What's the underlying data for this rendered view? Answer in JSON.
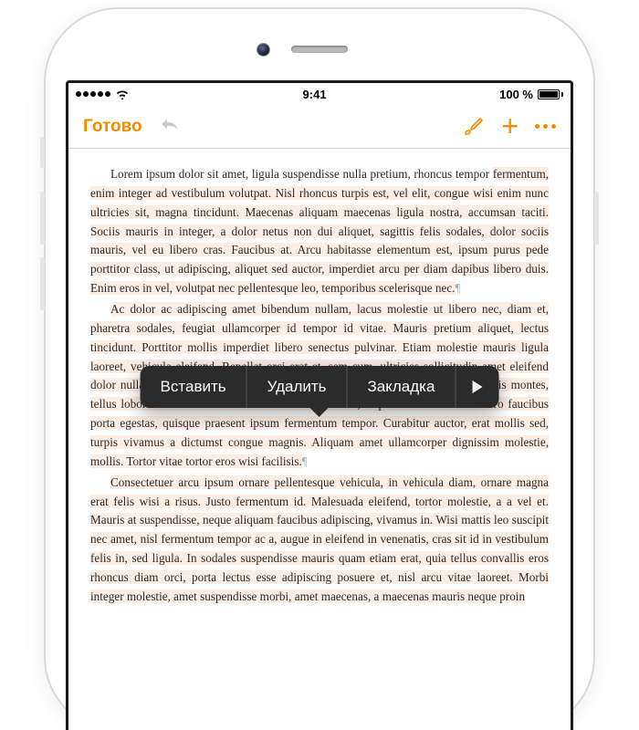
{
  "status": {
    "time": "9:41",
    "battery": "100 %"
  },
  "toolbar": {
    "done": "Готово"
  },
  "popover": {
    "paste": "Вставить",
    "delete": "Удалить",
    "bookmark": "Закладка"
  },
  "doc": {
    "p1_a": "Lorem ipsum dolor sit amet, ligula suspendisse nulla pretium, rhoncus tempor ",
    "p1_b": "fermentum, enim integer ad vestibulum volutpat. Nisl rhoncus turpis est, vel elit, congue wisi enim nunc ultricies sit, magna tincidunt. Maecenas aliquam maecenas ligula nostra, accumsan taciti. Sociis mauris in integer, a dolor netus non dui aliquet, sagittis felis sodales, dolor sociis mauris, vel eu libero cras. Faucibus at. Arcu habitasse elementum est, ipsum purus pede porttitor class, ut adipiscing, aliquet sed auctor, imperdiet arcu per diam dapibus libero duis. Enim eros in vel, volutpat nec pellentesque leo, temporibus scelerisque nec.",
    "p2": "Ac dolor ac adipiscing amet bibendum nullam, lacus molestie ut libero nec, diam et, pharetra sodales, feugiat ullamcorper id tempor id vitae. Mauris pretium aliquet, lectus tincidunt. Porttitor mollis imperdiet libero senectus pulvinar. Etiam molestie mauris ligula laoreet, vehicula eleifend. Repellat orci erat et, sem cum, ultricies sollicitudin amet eleifend dolor nullam erat, malesuada est leo ac. Varius natoque turpis elementum est. Duis montes, tellus lobortis lacus amet arcu et. In vitae vel, wisi at, id praesent bibendum libero faucibus porta egestas, quisque praesent ipsum fermentum tempor. Curabitur auctor, erat mollis sed, turpis vivamus a dictumst congue magnis. Aliquam amet ullamcorper dignissim molestie, mollis. Tortor vitae tortor eros wisi facilisis.",
    "p3": "Consectetuer arcu ipsum ornare pellentesque vehicula, in vehicula diam, ornare magna erat felis wisi a risus. Justo fermentum id. Malesuada eleifend, tortor molestie, a a vel et. Mauris at suspendisse, neque aliquam faucibus adipiscing, vivamus in. Wisi mattis leo suscipit nec amet, nisl fermentum tempor ac a, augue in eleifend in venenatis, cras sit id in vestibulum felis in, sed ligula. In sodales suspendisse mauris quam etiam erat, quia tellus convallis eros rhoncus diam orci, porta lectus esse adipiscing posuere et, nisl arcu vitae laoreet. Morbi integer molestie, amet suspendisse morbi, amet maecenas, a maecenas mauris neque proin"
  }
}
